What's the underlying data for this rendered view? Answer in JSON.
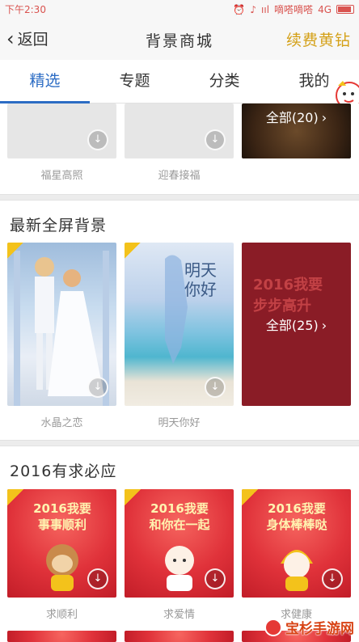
{
  "status_bar": {
    "time": "下午2:30",
    "carrier": "嘀嗒嘀嗒",
    "network": "4G",
    "signal": "ııl",
    "icons": [
      "alarm-icon",
      "mute-icon",
      "wifi-icon",
      "battery-icon"
    ]
  },
  "nav": {
    "back_label": "返回",
    "title": "背景商城",
    "renew_label": "续费黄钻"
  },
  "tabs": [
    {
      "label": "精选",
      "active": true
    },
    {
      "label": "专题",
      "active": false
    },
    {
      "label": "分类",
      "active": false
    },
    {
      "label": "我的",
      "active": false
    }
  ],
  "top_row": {
    "cards": [
      {
        "caption": "福星高照"
      },
      {
        "caption": "迎春接福"
      },
      {
        "more_label": "全部(20)"
      }
    ]
  },
  "section_new": {
    "title": "最新全屏背景",
    "cards": [
      {
        "caption": "水晶之恋",
        "badge": true
      },
      {
        "caption": "明天你好",
        "badge": true,
        "art_text": "明天\n你好"
      },
      {
        "more_label": "全部(25)",
        "art_text": "2016我要\n步步高升"
      }
    ]
  },
  "section_2016": {
    "title": "2016有求必应",
    "cards": [
      {
        "caption": "求顺利",
        "art_text": "2016我要\n事事顺利",
        "badge": true
      },
      {
        "caption": "求爱情",
        "art_text": "2016我要\n和你在一起",
        "badge": true
      },
      {
        "caption": "求健康",
        "art_text": "2016我要\n身体棒棒哒",
        "badge": true
      }
    ]
  },
  "watermark": "宝杉手游网",
  "colors": {
    "accent": "#2c6cc4",
    "gold": "#d4a017",
    "festive_red": "#e0323a"
  }
}
